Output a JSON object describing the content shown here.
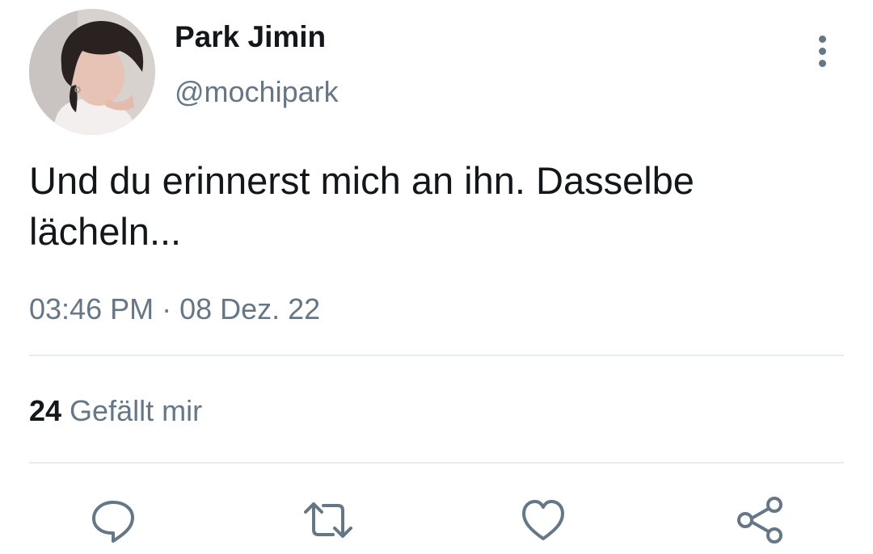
{
  "tweet": {
    "display_name": "Park Jimin",
    "handle": "@mochipark",
    "text_line1": "Und du erinnerst mich an ihn. Dasselbe",
    "text_line2": "lächeln...",
    "timestamp": "03:46 PM · 08 Dez. 22",
    "likes_count": "24",
    "likes_label": "Gefällt mir"
  },
  "icons": {
    "more": "vertical-ellipsis-icon",
    "reply": "speech-bubble-icon",
    "retweet": "retweet-arrows-icon",
    "like": "heart-outline-icon",
    "share": "share-nodes-icon"
  },
  "colors": {
    "text_primary": "#14171a",
    "text_secondary": "#657786",
    "divider": "#e6ecf0"
  }
}
